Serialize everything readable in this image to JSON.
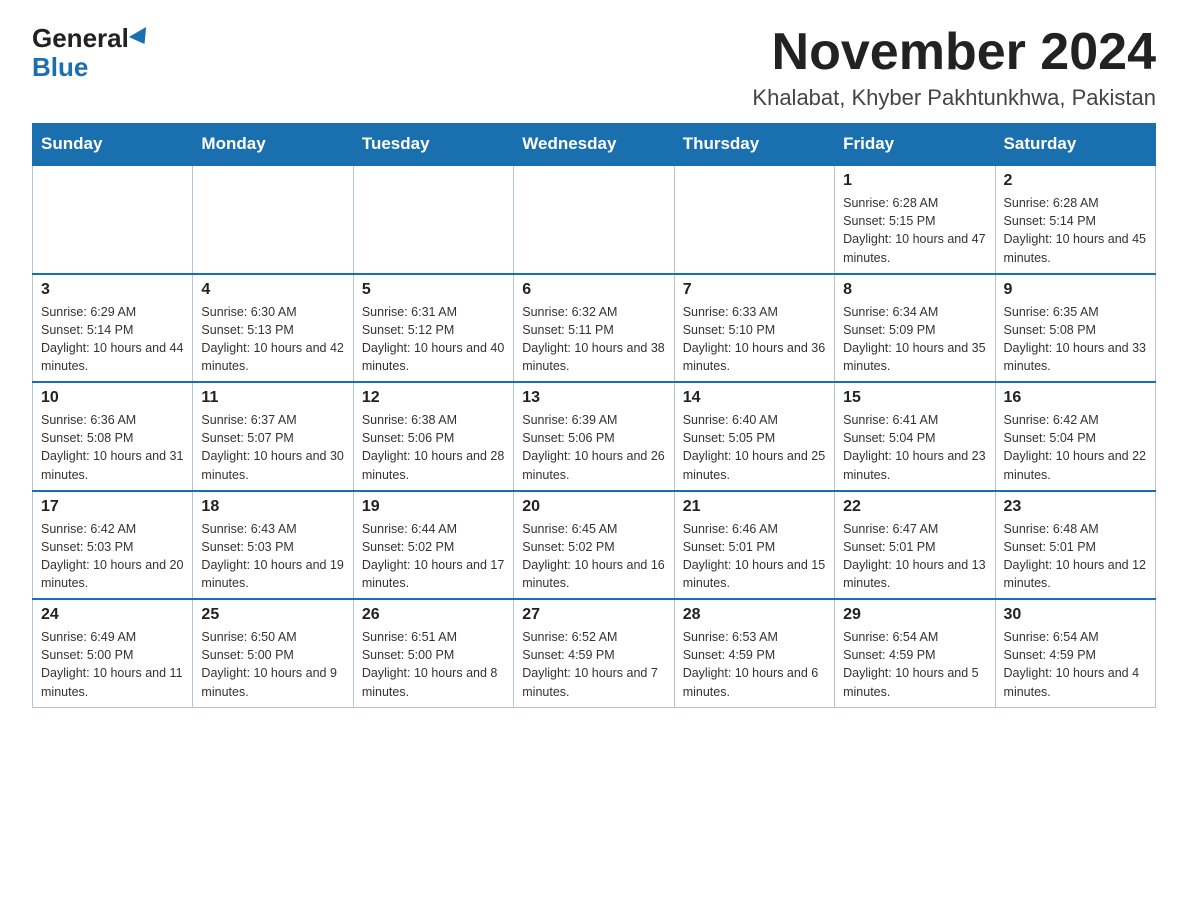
{
  "header": {
    "logo_general": "General",
    "logo_blue": "Blue",
    "title": "November 2024",
    "subtitle": "Khalabat, Khyber Pakhtunkhwa, Pakistan"
  },
  "weekdays": [
    "Sunday",
    "Monday",
    "Tuesday",
    "Wednesday",
    "Thursday",
    "Friday",
    "Saturday"
  ],
  "weeks": [
    [
      {
        "day": "",
        "sunrise": "",
        "sunset": "",
        "daylight": ""
      },
      {
        "day": "",
        "sunrise": "",
        "sunset": "",
        "daylight": ""
      },
      {
        "day": "",
        "sunrise": "",
        "sunset": "",
        "daylight": ""
      },
      {
        "day": "",
        "sunrise": "",
        "sunset": "",
        "daylight": ""
      },
      {
        "day": "",
        "sunrise": "",
        "sunset": "",
        "daylight": ""
      },
      {
        "day": "1",
        "sunrise": "Sunrise: 6:28 AM",
        "sunset": "Sunset: 5:15 PM",
        "daylight": "Daylight: 10 hours and 47 minutes."
      },
      {
        "day": "2",
        "sunrise": "Sunrise: 6:28 AM",
        "sunset": "Sunset: 5:14 PM",
        "daylight": "Daylight: 10 hours and 45 minutes."
      }
    ],
    [
      {
        "day": "3",
        "sunrise": "Sunrise: 6:29 AM",
        "sunset": "Sunset: 5:14 PM",
        "daylight": "Daylight: 10 hours and 44 minutes."
      },
      {
        "day": "4",
        "sunrise": "Sunrise: 6:30 AM",
        "sunset": "Sunset: 5:13 PM",
        "daylight": "Daylight: 10 hours and 42 minutes."
      },
      {
        "day": "5",
        "sunrise": "Sunrise: 6:31 AM",
        "sunset": "Sunset: 5:12 PM",
        "daylight": "Daylight: 10 hours and 40 minutes."
      },
      {
        "day": "6",
        "sunrise": "Sunrise: 6:32 AM",
        "sunset": "Sunset: 5:11 PM",
        "daylight": "Daylight: 10 hours and 38 minutes."
      },
      {
        "day": "7",
        "sunrise": "Sunrise: 6:33 AM",
        "sunset": "Sunset: 5:10 PM",
        "daylight": "Daylight: 10 hours and 36 minutes."
      },
      {
        "day": "8",
        "sunrise": "Sunrise: 6:34 AM",
        "sunset": "Sunset: 5:09 PM",
        "daylight": "Daylight: 10 hours and 35 minutes."
      },
      {
        "day": "9",
        "sunrise": "Sunrise: 6:35 AM",
        "sunset": "Sunset: 5:08 PM",
        "daylight": "Daylight: 10 hours and 33 minutes."
      }
    ],
    [
      {
        "day": "10",
        "sunrise": "Sunrise: 6:36 AM",
        "sunset": "Sunset: 5:08 PM",
        "daylight": "Daylight: 10 hours and 31 minutes."
      },
      {
        "day": "11",
        "sunrise": "Sunrise: 6:37 AM",
        "sunset": "Sunset: 5:07 PM",
        "daylight": "Daylight: 10 hours and 30 minutes."
      },
      {
        "day": "12",
        "sunrise": "Sunrise: 6:38 AM",
        "sunset": "Sunset: 5:06 PM",
        "daylight": "Daylight: 10 hours and 28 minutes."
      },
      {
        "day": "13",
        "sunrise": "Sunrise: 6:39 AM",
        "sunset": "Sunset: 5:06 PM",
        "daylight": "Daylight: 10 hours and 26 minutes."
      },
      {
        "day": "14",
        "sunrise": "Sunrise: 6:40 AM",
        "sunset": "Sunset: 5:05 PM",
        "daylight": "Daylight: 10 hours and 25 minutes."
      },
      {
        "day": "15",
        "sunrise": "Sunrise: 6:41 AM",
        "sunset": "Sunset: 5:04 PM",
        "daylight": "Daylight: 10 hours and 23 minutes."
      },
      {
        "day": "16",
        "sunrise": "Sunrise: 6:42 AM",
        "sunset": "Sunset: 5:04 PM",
        "daylight": "Daylight: 10 hours and 22 minutes."
      }
    ],
    [
      {
        "day": "17",
        "sunrise": "Sunrise: 6:42 AM",
        "sunset": "Sunset: 5:03 PM",
        "daylight": "Daylight: 10 hours and 20 minutes."
      },
      {
        "day": "18",
        "sunrise": "Sunrise: 6:43 AM",
        "sunset": "Sunset: 5:03 PM",
        "daylight": "Daylight: 10 hours and 19 minutes."
      },
      {
        "day": "19",
        "sunrise": "Sunrise: 6:44 AM",
        "sunset": "Sunset: 5:02 PM",
        "daylight": "Daylight: 10 hours and 17 minutes."
      },
      {
        "day": "20",
        "sunrise": "Sunrise: 6:45 AM",
        "sunset": "Sunset: 5:02 PM",
        "daylight": "Daylight: 10 hours and 16 minutes."
      },
      {
        "day": "21",
        "sunrise": "Sunrise: 6:46 AM",
        "sunset": "Sunset: 5:01 PM",
        "daylight": "Daylight: 10 hours and 15 minutes."
      },
      {
        "day": "22",
        "sunrise": "Sunrise: 6:47 AM",
        "sunset": "Sunset: 5:01 PM",
        "daylight": "Daylight: 10 hours and 13 minutes."
      },
      {
        "day": "23",
        "sunrise": "Sunrise: 6:48 AM",
        "sunset": "Sunset: 5:01 PM",
        "daylight": "Daylight: 10 hours and 12 minutes."
      }
    ],
    [
      {
        "day": "24",
        "sunrise": "Sunrise: 6:49 AM",
        "sunset": "Sunset: 5:00 PM",
        "daylight": "Daylight: 10 hours and 11 minutes."
      },
      {
        "day": "25",
        "sunrise": "Sunrise: 6:50 AM",
        "sunset": "Sunset: 5:00 PM",
        "daylight": "Daylight: 10 hours and 9 minutes."
      },
      {
        "day": "26",
        "sunrise": "Sunrise: 6:51 AM",
        "sunset": "Sunset: 5:00 PM",
        "daylight": "Daylight: 10 hours and 8 minutes."
      },
      {
        "day": "27",
        "sunrise": "Sunrise: 6:52 AM",
        "sunset": "Sunset: 4:59 PM",
        "daylight": "Daylight: 10 hours and 7 minutes."
      },
      {
        "day": "28",
        "sunrise": "Sunrise: 6:53 AM",
        "sunset": "Sunset: 4:59 PM",
        "daylight": "Daylight: 10 hours and 6 minutes."
      },
      {
        "day": "29",
        "sunrise": "Sunrise: 6:54 AM",
        "sunset": "Sunset: 4:59 PM",
        "daylight": "Daylight: 10 hours and 5 minutes."
      },
      {
        "day": "30",
        "sunrise": "Sunrise: 6:54 AM",
        "sunset": "Sunset: 4:59 PM",
        "daylight": "Daylight: 10 hours and 4 minutes."
      }
    ]
  ]
}
